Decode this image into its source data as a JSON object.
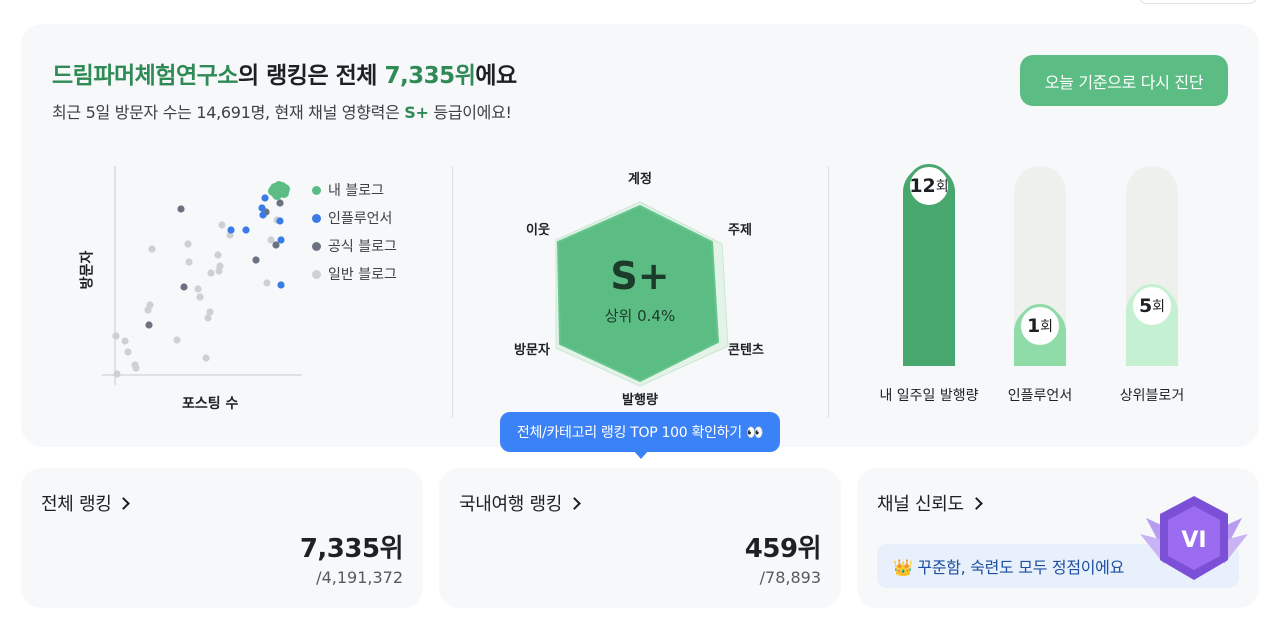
{
  "header": {
    "channel_name": "드림파머체험연구소",
    "title_mid": "의 랭킹은 전체 ",
    "rank_text": "7,335위",
    "title_end": "에요",
    "sub_prefix": "최근 5일 방문자 수는 14,691명, 현재 채널 영향력은 ",
    "grade": "S+",
    "sub_suffix": " 등급이에요!",
    "rediagnose_button": "오늘 기준으로 다시 진단"
  },
  "scatter": {
    "x_label": "포스팅 수",
    "y_label": "방문자",
    "legend": [
      {
        "label": "내 블로그",
        "color": "#5cbd84"
      },
      {
        "label": "인플루언서",
        "color": "#3b7be8"
      },
      {
        "label": "공식 블로그",
        "color": "#6b7280"
      },
      {
        "label": "일반 블로그",
        "color": "#cdd0d4"
      }
    ]
  },
  "radar": {
    "grade": "S+",
    "percentile": "상위 0.4%",
    "axes": [
      "계정",
      "주제",
      "콘텐츠",
      "발행량",
      "방문자",
      "이웃"
    ]
  },
  "bars": {
    "unit": "회",
    "items": [
      {
        "label": "내 일주일 발행량",
        "value": "12",
        "ratio": 1.0,
        "color": "#48a66f",
        "badge_border": "#48a66f"
      },
      {
        "label": "인플루언서",
        "value": "1",
        "ratio": 0.3,
        "color": "#8fdca8",
        "badge_border": "#8fdca8"
      },
      {
        "label": "상위블로거",
        "value": "5",
        "ratio": 0.4,
        "color": "#c6f0d2",
        "badge_border": "#c6f0d2"
      }
    ]
  },
  "cta": {
    "label": "전체/카테고리 랭킹 TOP 100 확인하기 👀"
  },
  "cards": {
    "overall": {
      "title": "전체 랭킹",
      "rank": "7,335위",
      "total": "/4,191,372"
    },
    "category": {
      "title": "국내여행 랭킹",
      "rank": "459위",
      "total": "/78,893"
    },
    "trust": {
      "title": "채널 신뢰도",
      "message": "👑 꾸준함, 숙련도 모두 정점이에요",
      "medal": "VI"
    }
  }
}
